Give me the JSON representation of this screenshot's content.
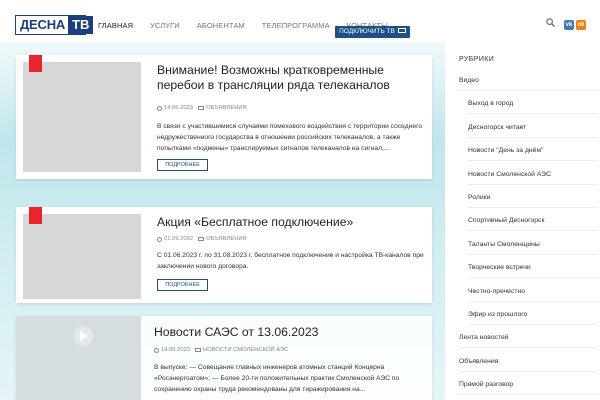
{
  "header": {
    "logo": {
      "part1": "ДЕСНА",
      "part2": "ТВ"
    },
    "nav": [
      "ГЛАВНАЯ",
      "УСЛУГИ",
      "АБОНЕНТАМ",
      "ТЕЛЕПРОГРАММА",
      "КОНТАКТЫ"
    ],
    "connect_label": "ПОДКЛЮЧИТЬ ТВ",
    "vk_label": "vk",
    "ok_label": "ok"
  },
  "posts": [
    {
      "title": "Внимание! Возможны кратковременные перебои в трансляции ряда телеканалов",
      "date": "14.06.2023",
      "category": "ОБЪЯВЛЕНИЯ",
      "excerpt": "В связи с участившимися случаями помехового воздействия с территории соседнего недружественного государства в отношении российских телеканалов, а также попытками «подмены» транслируемых сигналов телеканалов на сигнал,...",
      "more": "ПОДРОБНЕЕ"
    },
    {
      "title": "Акция «Бесплатное подключение»",
      "date": "01.09.2022",
      "category": "ОБЪЯВЛЕНИЯ",
      "excerpt": "С 01.06.2023 г. по 31.08.2023 г. бесплатное подключение и настройка ТВ-каналов при заключении нового договора.",
      "more": "ПОДРОБНЕЕ"
    },
    {
      "title": "Новости САЭС от 13.06.2023",
      "date": "14.06.2023",
      "category": "НОВОСТИ СМОЛЕНСКОЙ АЭС",
      "excerpt": "В выпуске: — Совещание главных инженеров атомных станций Концерна «Росэнергоатом»; — Более 20-ти положительных практик Смоленской АЭС по сохранению охраны труда рекомендованы для тиражирования на..."
    }
  ],
  "sidebar": {
    "heading": "РУБРИКИ",
    "items": [
      {
        "label": "Видео",
        "level": 0
      },
      {
        "label": "Выход в город",
        "level": 1
      },
      {
        "label": "Десногорск читает",
        "level": 1
      },
      {
        "label": "Новости \"День за днём\"",
        "level": 1
      },
      {
        "label": "Новости Смоленской АЭС",
        "level": 1
      },
      {
        "label": "Ролики",
        "level": 1
      },
      {
        "label": "Спортивный Десногорск",
        "level": 1
      },
      {
        "label": "Таланты Смоленщины",
        "level": 1
      },
      {
        "label": "Творческие встречи",
        "level": 1
      },
      {
        "label": "Честно-пречестно",
        "level": 1
      },
      {
        "label": "Эфир из прошлого",
        "level": 1
      },
      {
        "label": "Лента новостей",
        "level": 0
      },
      {
        "label": "Объявления",
        "level": 0
      },
      {
        "label": "Прямой разговор",
        "level": 0
      }
    ]
  },
  "colors": {
    "brand": "#1c3f7a",
    "accent": "#1e4f86",
    "flag": "#e8242c"
  }
}
